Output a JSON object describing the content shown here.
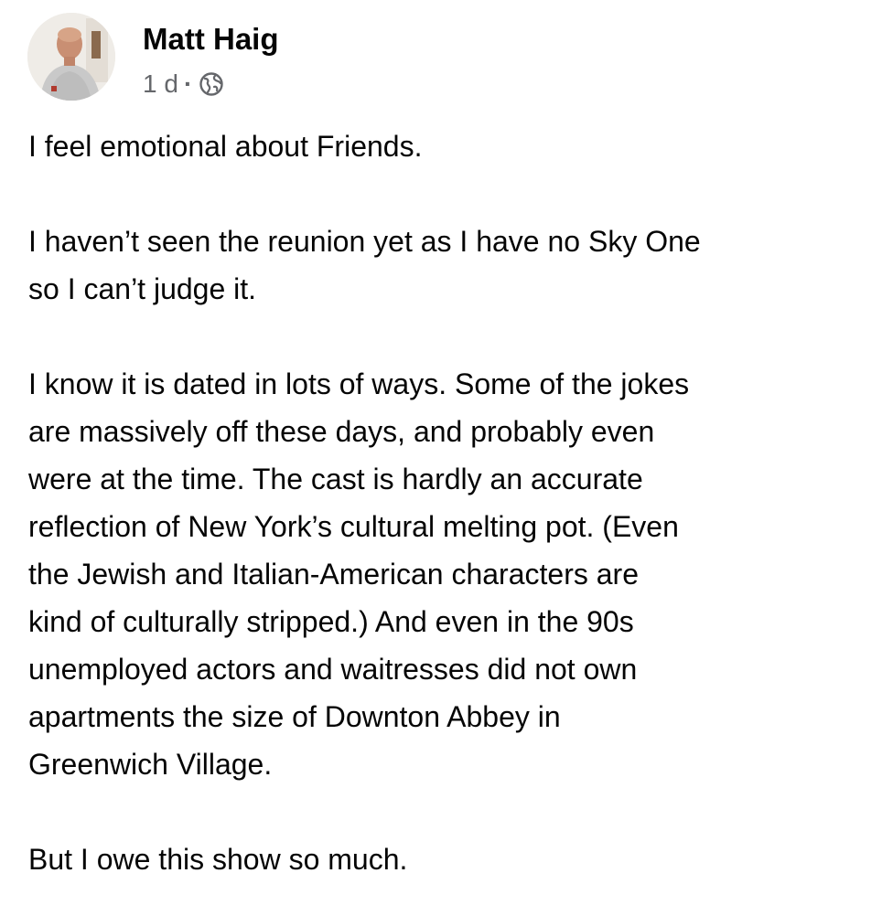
{
  "post": {
    "author": {
      "name": "Matt Haig"
    },
    "meta": {
      "time": "1 d",
      "separator": "·",
      "audience_icon": "globe-icon"
    },
    "paragraphs": [
      "I feel emotional about Friends.",
      "I haven’t seen the reunion yet as I have no Sky One\nso I can’t judge it.",
      "I know it is dated in lots of ways. Some of the jokes\nare massively off these days, and probably even\nwere at the time. The cast is hardly an accurate\nreflection of New York’s cultural melting pot. (Even\nthe Jewish and Italian-American characters are\nkind of culturally stripped.) And even in the 90s\nunemployed actors and waitresses did not own\napartments the size of Downton Abbey in\nGreenwich Village.",
      "But I owe this show so much."
    ]
  },
  "colors": {
    "text_primary": "#050505",
    "text_secondary": "#65676b",
    "background": "#ffffff"
  }
}
